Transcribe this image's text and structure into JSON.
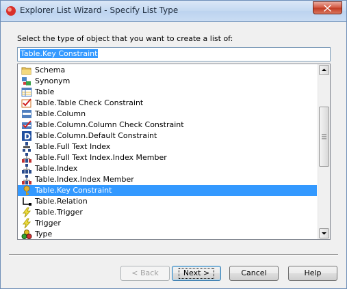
{
  "window": {
    "title": "Explorer List Wizard - Specify List Type"
  },
  "prompt": "Select the type of object that you want to create a  list of:",
  "filter": {
    "value": "Table.Key Constraint"
  },
  "list": {
    "items": [
      {
        "label": "Schema",
        "icon": "folder-icon"
      },
      {
        "label": "Synonym",
        "icon": "synonym-icon"
      },
      {
        "label": "Table",
        "icon": "table-icon"
      },
      {
        "label": "Table.Table Check Constraint",
        "icon": "check-constraint-icon"
      },
      {
        "label": "Table.Column",
        "icon": "column-icon"
      },
      {
        "label": "Table.Column.Column Check Constraint",
        "icon": "column-check-constraint-icon"
      },
      {
        "label": "Table.Column.Default Constraint",
        "icon": "default-constraint-icon"
      },
      {
        "label": "Table.Full Text Index",
        "icon": "fulltext-index-icon"
      },
      {
        "label": "Table.Full Text Index.Index Member",
        "icon": "index-member-icon"
      },
      {
        "label": "Table.Index",
        "icon": "index-icon"
      },
      {
        "label": "Table.Index.Index Member",
        "icon": "index-member-icon"
      },
      {
        "label": "Table.Key Constraint",
        "icon": "key-icon",
        "selected": true
      },
      {
        "label": "Table.Relation",
        "icon": "relation-icon"
      },
      {
        "label": "Table.Trigger",
        "icon": "trigger-icon"
      },
      {
        "label": "Trigger",
        "icon": "trigger-icon"
      },
      {
        "label": "Type",
        "icon": "type-icon"
      }
    ]
  },
  "buttons": {
    "back": "< Back",
    "next": "Next >",
    "cancel": "Cancel",
    "help": "Help"
  },
  "colors": {
    "selection": "#3399ff",
    "window_bg": "#f0f0f0"
  }
}
